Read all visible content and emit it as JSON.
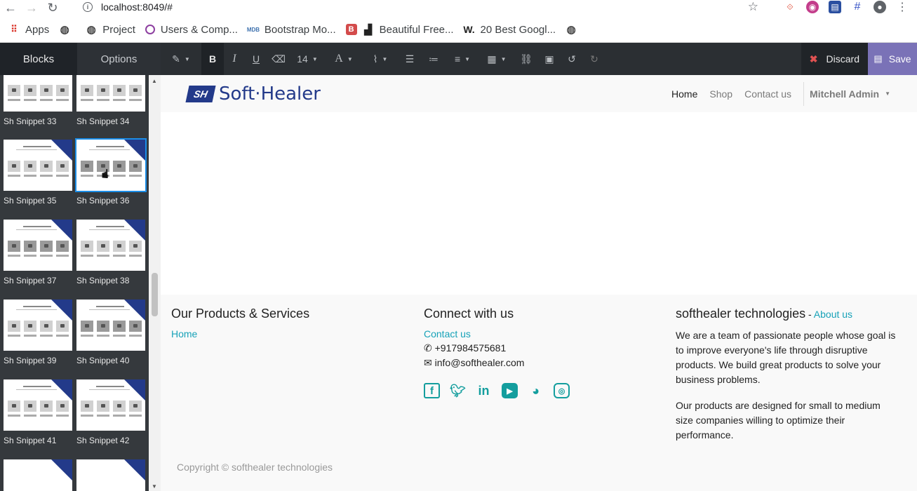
{
  "browser": {
    "url": "localhost:8049/#",
    "bookmarks": [
      {
        "label": "Apps",
        "icon": "apps-grid-icon"
      },
      {
        "label": "",
        "icon": "globe-icon"
      },
      {
        "label": "Project",
        "icon": "globe-icon"
      },
      {
        "label": "Users & Comp...",
        "icon": "ring-icon"
      },
      {
        "label": "Bootstrap Mo...",
        "icon": "mdb-icon"
      },
      {
        "label": "Beautiful Free...",
        "icon": "b-icon"
      },
      {
        "label": "20 Best Googl...",
        "icon": "w-icon"
      },
      {
        "label": "",
        "icon": "globe-icon"
      }
    ]
  },
  "sidebar": {
    "tabs": [
      "Blocks",
      "Options"
    ],
    "snippets": [
      "Sh Snippet 33",
      "Sh Snippet 34",
      "Sh Snippet 35",
      "Sh Snippet 36",
      "Sh Snippet 37",
      "Sh Snippet 38",
      "Sh Snippet 39",
      "Sh Snippet 40",
      "Sh Snippet 41",
      "Sh Snippet 42"
    ]
  },
  "toolbar": {
    "font_size": "14",
    "discard_label": "Discard",
    "save_label": "Save"
  },
  "site": {
    "logo_mark": "SH",
    "logo_text": "Soft·Healer",
    "menu": [
      "Home",
      "Shop",
      "Contact us"
    ],
    "user": "Mitchell Admin",
    "footer": {
      "col1_title": "Our Products & Services",
      "col1_link": "Home",
      "col2_title": "Connect with us",
      "col2_link": "Contact us",
      "phone": "+917984575681",
      "email": "info@softhealer.com",
      "col3_title": "softhealer technologies",
      "col3_link": "About us",
      "about_p1": "We are a team of passionate people whose goal is to improve everyone's life through disruptive products. We build great products to solve your business problems.",
      "about_p2": "Our products are designed for small to medium size companies willing to optimize their performance.",
      "copyright": "Copyright © softhealer technologies"
    }
  },
  "colors": {
    "accent": "#17a2b8",
    "save": "#7a72b7",
    "brand": "#233a8a"
  }
}
